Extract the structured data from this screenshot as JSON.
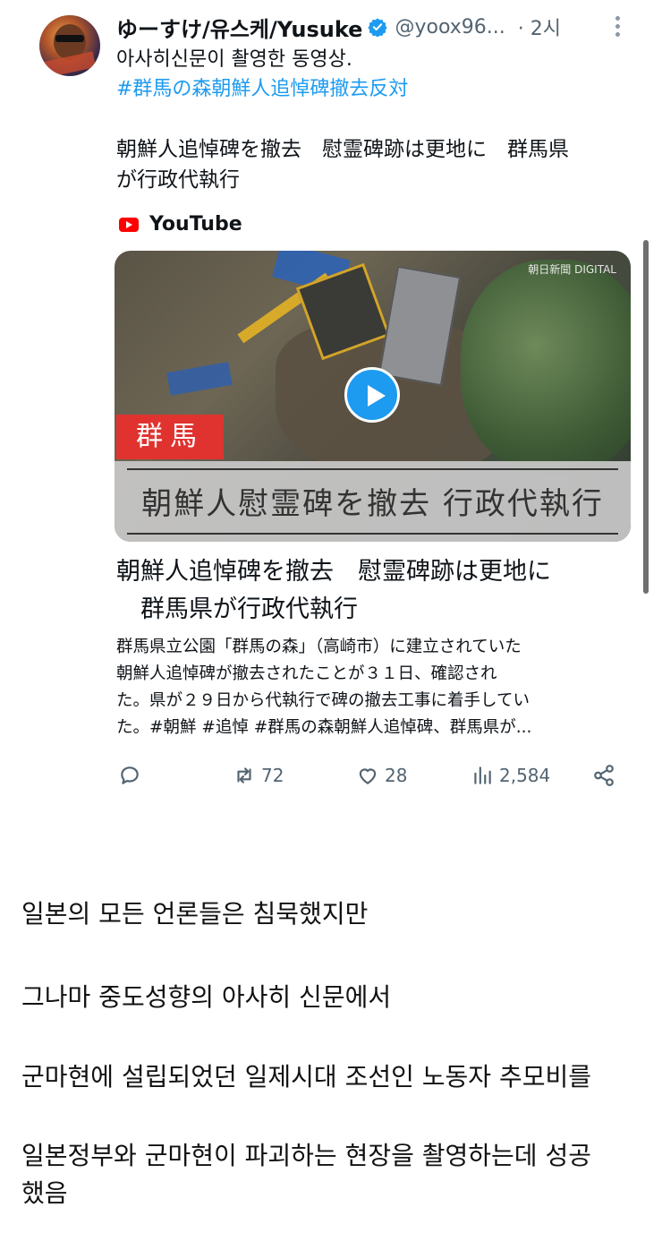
{
  "tweet": {
    "display_name": "ゆーすけ/유스케/Yusuke",
    "handle": "@yoox96...",
    "time": "· 2시",
    "text_line1": "아사히신문이 촬영한 동영상.",
    "hashtag": "#群馬の森朝鮮人追悼碑撤去反対"
  },
  "preview": {
    "title_line1": "朝鮮人追悼碑を撤去　慰霊碑跡は更地に　群馬県",
    "title_line2": "が行政代執行",
    "source": "YouTube"
  },
  "video": {
    "region_label": "群馬",
    "banner_text": "朝鮮人慰霊碑を撤去 行政代執行",
    "logo_text": "朝日新聞 DIGITAL"
  },
  "card": {
    "title_line1": "朝鮮人追悼碑を撤去　慰霊碑跡は更地に",
    "title_line2": "　群馬県が行政代執行",
    "desc_line1": "群馬県立公園「群馬の森」（高崎市）に建立されていた",
    "desc_line2": "朝鮮人追悼碑が撤去されたことが３１日、確認され",
    "desc_line3": "た。県が２９日から代執行で碑の撤去工事に着手してい",
    "desc_line4": "た。#朝鮮 #追悼 #群馬の森朝鮮人追悼碑、群馬県が..."
  },
  "actions": {
    "retweets": "72",
    "likes": "28",
    "views": "2,584"
  },
  "post_body": {
    "line1": "일본의 모든 언론들은 침묵했지만",
    "line2": "그나마 중도성향의 아사히 신문에서",
    "line3": "군마현에 설립되었던 일제시대 조선인 노동자 추모비를",
    "line4a": "일본정부와 군마현이 파괴하는 현장을 촬영하는데 성공",
    "line4b": "했음"
  },
  "colors": {
    "link": "#1d9bf0",
    "muted": "#536471",
    "youtube": "#ff0000",
    "region_red": "#e0332f"
  }
}
